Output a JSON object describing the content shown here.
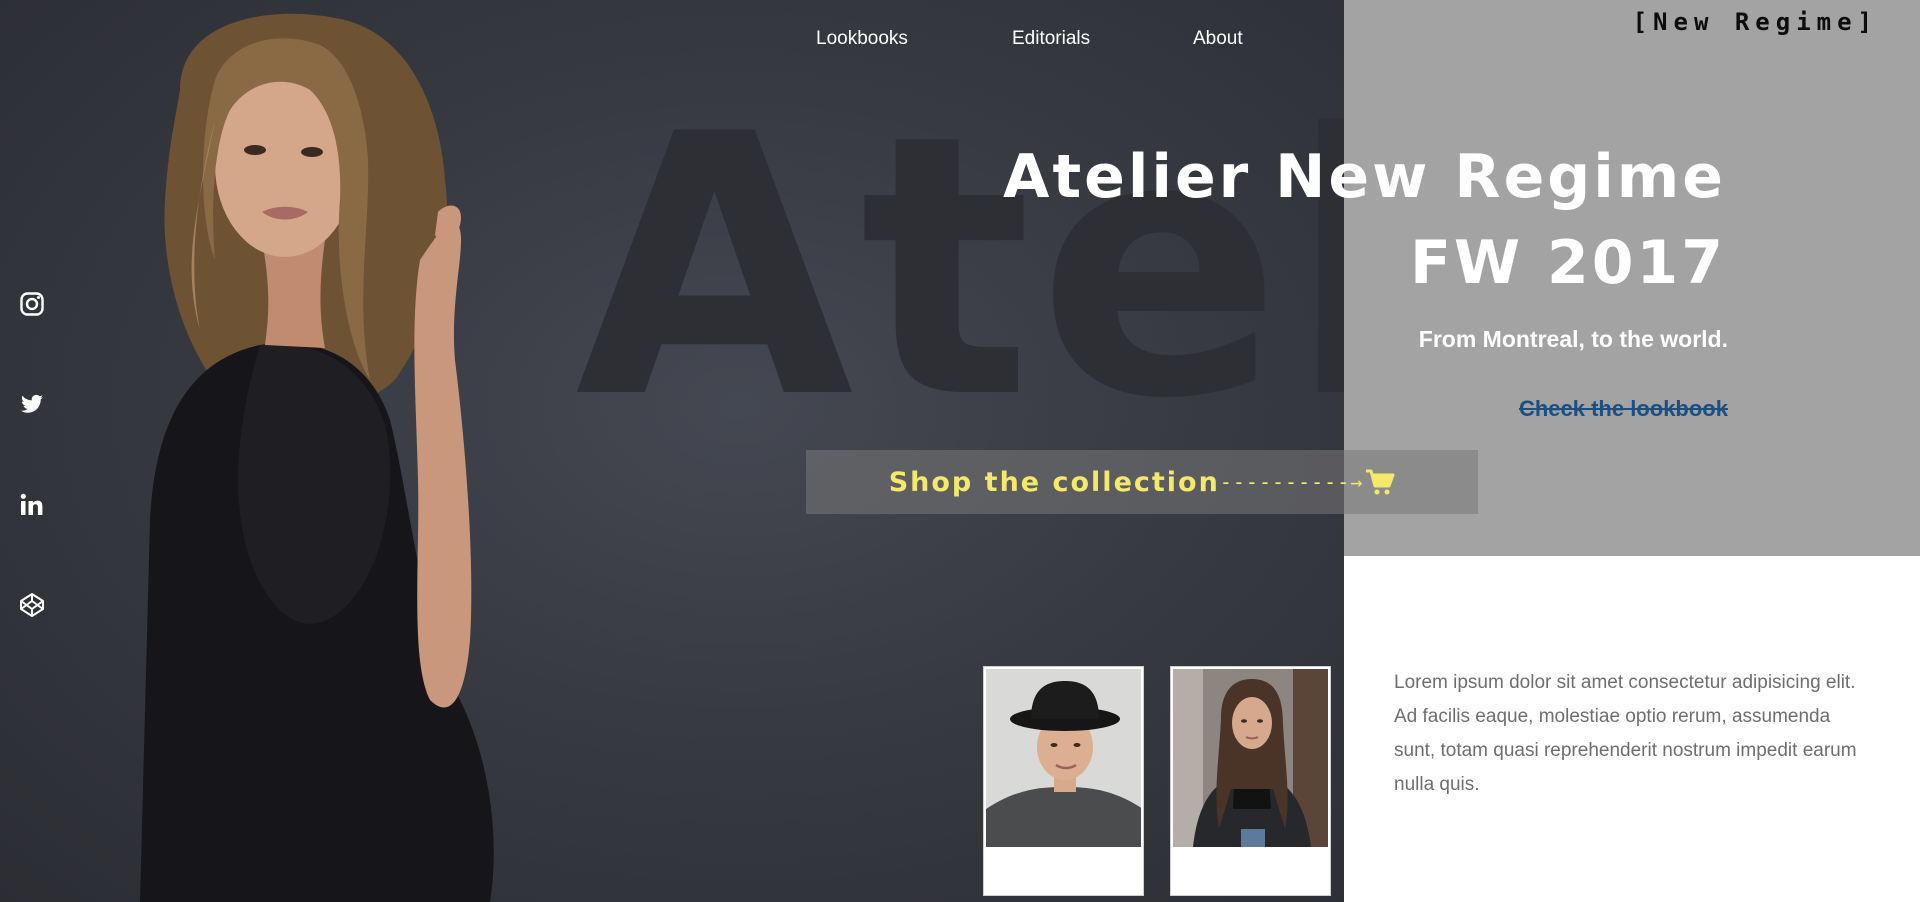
{
  "brand": {
    "name": "[New Regime]"
  },
  "nav": {
    "items": [
      "Lookbooks",
      "Editorials",
      "About"
    ]
  },
  "watermark": "Atelier",
  "hero": {
    "title_line1": "Atelier New Regime",
    "title_line2": "FW 2017",
    "tagline": "From Montreal, to the world.",
    "lookbook_link": "Check the lookbook",
    "shop_label": "Shop the collection",
    "shop_arrow": "----------→"
  },
  "social": [
    "instagram-icon",
    "twitter-icon",
    "linkedin-icon",
    "codepen-icon"
  ],
  "info": {
    "text": "Lorem ipsum dolor sit amet consectetur adipisicing elit. Ad facilis eaque, molestiae optio rerum, assumenda sunt, totam quasi reprehenderit nostrum impedit earum nulla quis."
  },
  "colors": {
    "hero_bg": "#383a42",
    "panel_gray": "#a3a3a3",
    "shop_text": "#f5e96a",
    "link": "#1c4f82"
  }
}
